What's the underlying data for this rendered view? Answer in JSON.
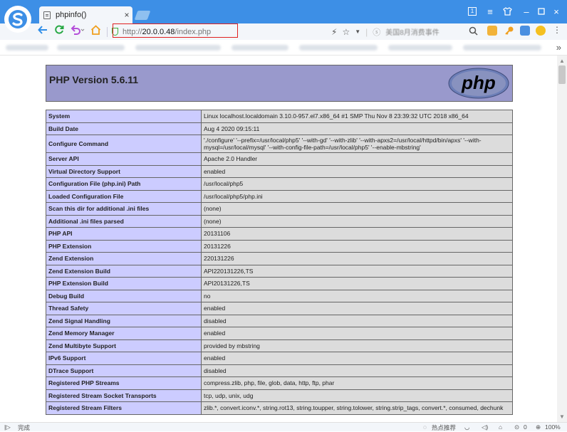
{
  "browser": {
    "tab_title": "phpinfo()",
    "tab_close": "×",
    "url_protocol": "http://",
    "url_host": "20.0.0.48",
    "url_path": "/index.php",
    "search_placeholder": "美国8月消费事件",
    "window_controls": [
      "1",
      "≡",
      "□",
      "–",
      "□",
      "×"
    ],
    "more": "»",
    "accent_color": "#3d8fe6",
    "highlight_color": "#e02020"
  },
  "status": {
    "left_label": "完成",
    "hot_label": "热点推荐",
    "download_count": "0",
    "zoom": "100%"
  },
  "page": {
    "title": "PHP Version 5.6.11",
    "logo_text": "php",
    "rows": [
      {
        "k": "System",
        "v": "Linux localhost.localdomain 3.10.0-957.el7.x86_64 #1 SMP Thu Nov 8 23:39:32 UTC 2018 x86_64"
      },
      {
        "k": "Build Date",
        "v": "Aug 4 2020 09:15:11"
      },
      {
        "k": "Configure Command",
        "v": "'./configure' '--prefix=/usr/local/php5' '--with-gd' '--with-zlib' '--with-apxs2=/usr/local/httpd/bin/apxs' '--with-mysql=/usr/local/mysql' '--with-config-file-path=/usr/local/php5' '--enable-mbstring'"
      },
      {
        "k": "Server API",
        "v": "Apache 2.0 Handler"
      },
      {
        "k": "Virtual Directory Support",
        "v": "enabled"
      },
      {
        "k": "Configuration File (php.ini) Path",
        "v": "/usr/local/php5"
      },
      {
        "k": "Loaded Configuration File",
        "v": "/usr/local/php5/php.ini"
      },
      {
        "k": "Scan this dir for additional .ini files",
        "v": "(none)"
      },
      {
        "k": "Additional .ini files parsed",
        "v": "(none)"
      },
      {
        "k": "PHP API",
        "v": "20131106"
      },
      {
        "k": "PHP Extension",
        "v": "20131226"
      },
      {
        "k": "Zend Extension",
        "v": "220131226"
      },
      {
        "k": "Zend Extension Build",
        "v": "API220131226,TS"
      },
      {
        "k": "PHP Extension Build",
        "v": "API20131226,TS"
      },
      {
        "k": "Debug Build",
        "v": "no"
      },
      {
        "k": "Thread Safety",
        "v": "enabled"
      },
      {
        "k": "Zend Signal Handling",
        "v": "disabled"
      },
      {
        "k": "Zend Memory Manager",
        "v": "enabled"
      },
      {
        "k": "Zend Multibyte Support",
        "v": "provided by mbstring"
      },
      {
        "k": "IPv6 Support",
        "v": "enabled"
      },
      {
        "k": "DTrace Support",
        "v": "disabled"
      },
      {
        "k": "Registered PHP Streams",
        "v": "compress.zlib, php, file, glob, data, http, ftp, phar"
      },
      {
        "k": "Registered Stream Socket Transports",
        "v": "tcp, udp, unix, udg"
      },
      {
        "k": "Registered Stream Filters",
        "v": "zlib.*, convert.iconv.*, string.rot13, string.toupper, string.tolower, string.strip_tags, convert.*, consumed, dechunk"
      }
    ]
  }
}
